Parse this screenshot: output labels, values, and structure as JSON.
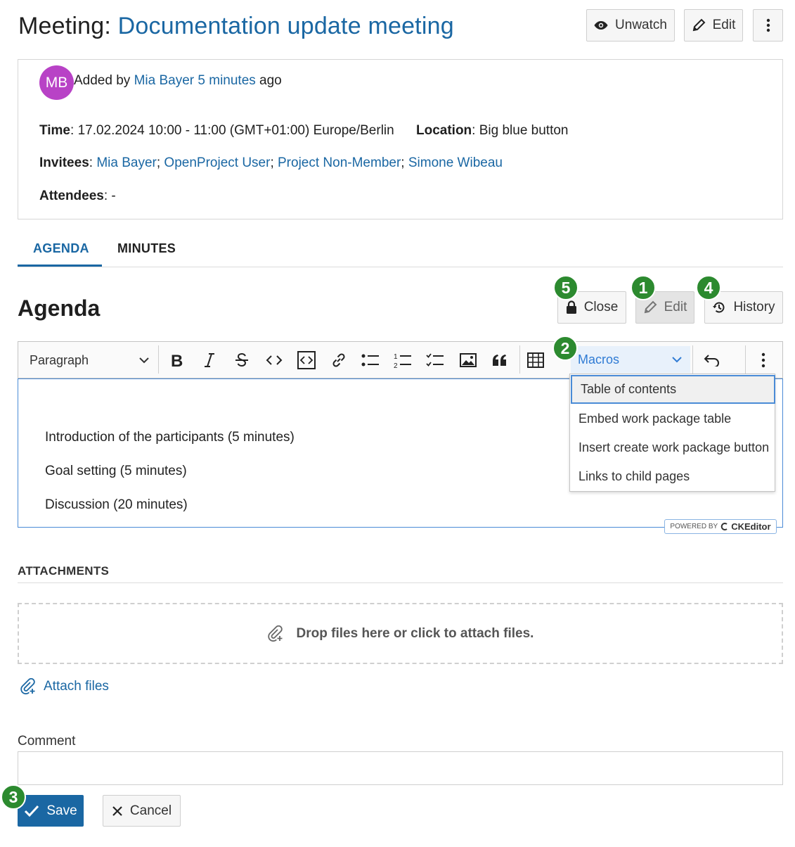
{
  "header": {
    "title_prefix": "Meeting:",
    "title_name": "Documentation update meeting",
    "unwatch_label": "Unwatch",
    "edit_label": "Edit"
  },
  "details": {
    "avatar_initials": "MB",
    "added_by_prefix": "Added by",
    "added_by_user": "Mia Bayer",
    "added_time": "5 minutes",
    "added_suffix": "ago",
    "time_label": "Time",
    "time_value": ": 17.02.2024 10:00 - 11:00 (GMT+01:00) Europe/Berlin",
    "location_label": "Location",
    "location_value": ": Big blue button",
    "invitees_label": "Invitees",
    "invitees": [
      "Mia Bayer",
      "OpenProject User",
      "Project Non-Member",
      "Simone Wibeau"
    ],
    "attendees_label": "Attendees",
    "attendees_value": ": -"
  },
  "tabs": [
    {
      "label": "AGENDA",
      "active": true
    },
    {
      "label": "MINUTES",
      "active": false
    }
  ],
  "agenda": {
    "heading": "Agenda",
    "close_label": "Close",
    "edit_label": "Edit",
    "history_label": "History"
  },
  "badges": {
    "close": "5",
    "edit": "1",
    "history": "4",
    "macros": "2",
    "save": "3"
  },
  "toolbar": {
    "paragraph_label": "Paragraph",
    "macros_label": "Macros",
    "icons": [
      "bold-icon",
      "italic-icon",
      "strikethrough-icon",
      "code-icon",
      "code-block-icon",
      "link-icon",
      "bulleted-list-icon",
      "numbered-list-icon",
      "todo-list-icon",
      "image-icon",
      "blockquote-icon",
      "table-icon",
      "undo-icon",
      "more-vertical-icon"
    ]
  },
  "editor": {
    "lines": [
      "Introduction of the participants (5 minutes)",
      "Goal setting (5 minutes)",
      "Discussion (20 minutes)"
    ],
    "powered_by": "POWERED BY",
    "ckeditor": "CKEditor"
  },
  "macros_menu": {
    "items": [
      "Table of contents",
      "Embed work package table",
      "Insert create work package button",
      "Links to child pages"
    ],
    "highlighted_index": 0
  },
  "attachments": {
    "heading": "ATTACHMENTS",
    "dropzone_text": "Drop files here or click to attach files.",
    "attach_link": "Attach files"
  },
  "form": {
    "comment_label": "Comment",
    "comment_value": "",
    "save_label": "Save",
    "cancel_label": "Cancel"
  },
  "colors": {
    "brand_blue": "#1a67a3",
    "badge_green": "#2c8a2f",
    "avatar_purple": "#b842c6",
    "focus_blue": "#4a8bd6"
  }
}
